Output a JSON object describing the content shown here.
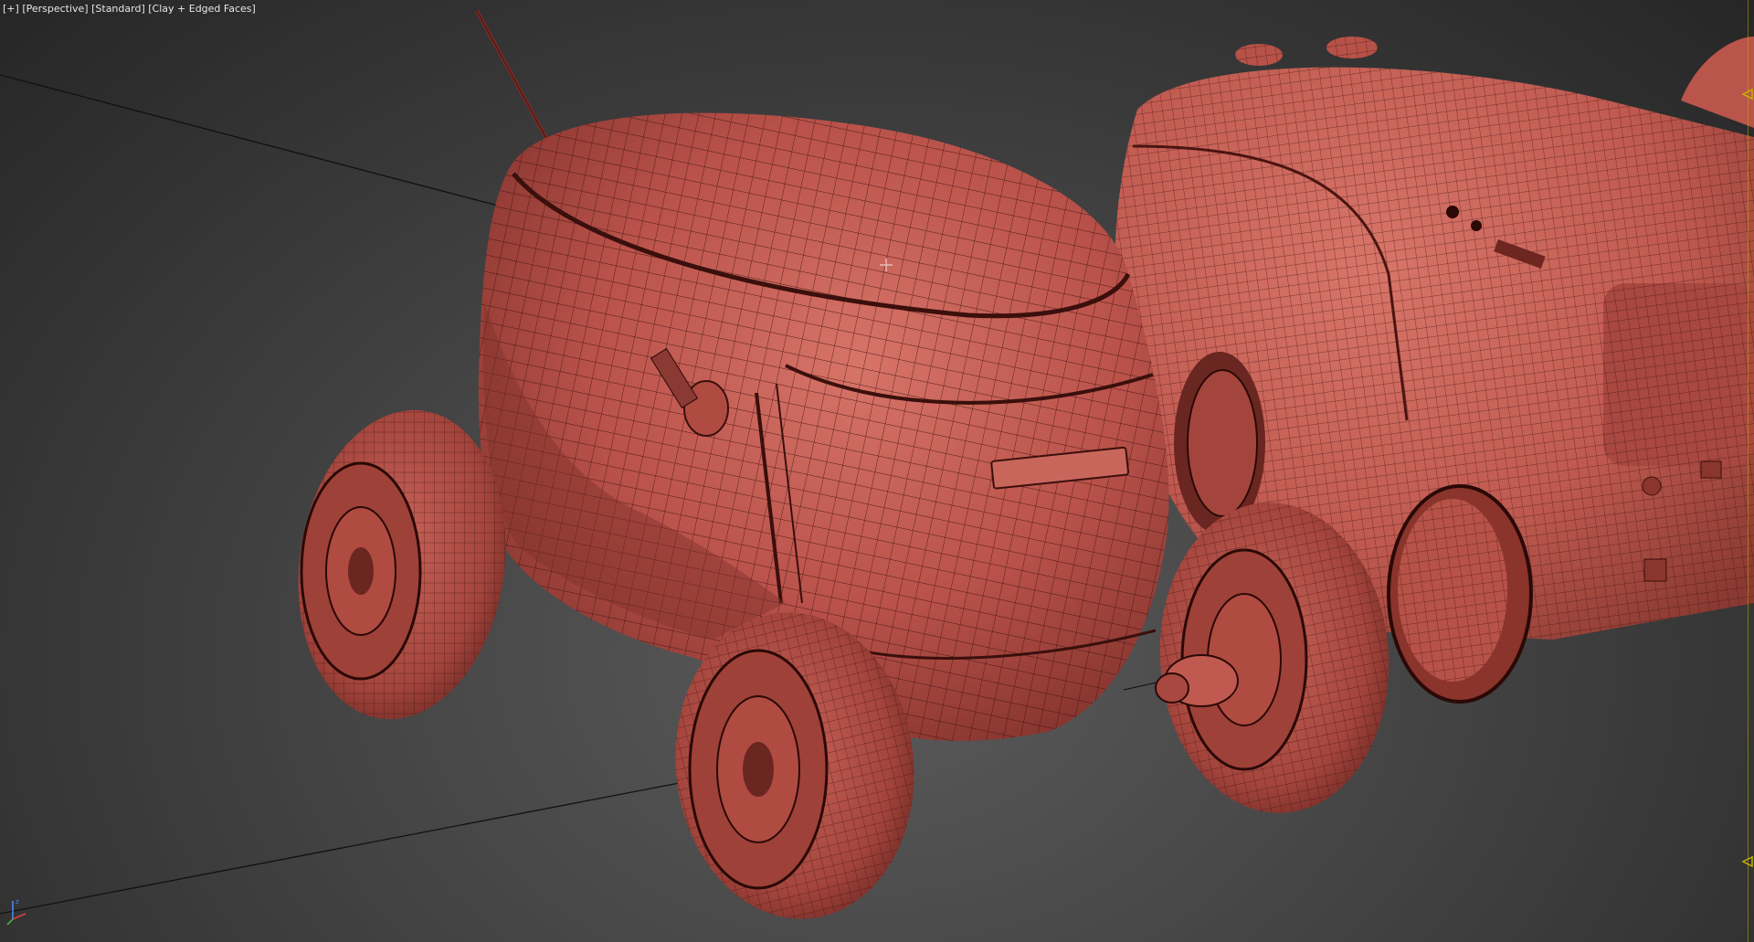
{
  "viewport": {
    "label_parts": [
      "[+]",
      "[Perspective]",
      "[Standard]",
      "[Clay + Edged Faces]"
    ]
  },
  "scene": {
    "objects": [
      "robot-rover-front",
      "robot-rover-back",
      "antenna",
      "wheels"
    ]
  },
  "colors": {
    "clay": "#c0574c",
    "clay_dark": "#8a3a32",
    "wire": "#3a0f0c",
    "background_center": "#555555",
    "background_edge": "#2a2a2a",
    "marker": "#c8b200"
  },
  "icons": {
    "axis_gizmo": "axis-tripod-icon",
    "cursor": "crosshair-cursor-icon",
    "right_markers": "triangle-marker-icon"
  }
}
